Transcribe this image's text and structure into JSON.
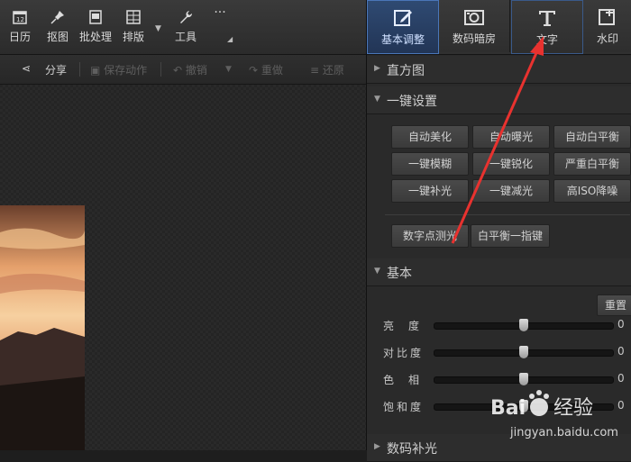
{
  "toolbar": {
    "items": [
      {
        "label": "日历",
        "icon": "calendar-icon"
      },
      {
        "label": "抠图",
        "icon": "pin-icon"
      },
      {
        "label": "批处理",
        "icon": "batch-icon"
      },
      {
        "label": "排版",
        "icon": "layout-icon"
      },
      {
        "label": "工具",
        "icon": "wrench-icon"
      }
    ],
    "more": "···"
  },
  "subtoolbar": {
    "share": "分享",
    "save_action": "保存动作",
    "undo": "撤销",
    "redo": "重做",
    "restore": "还原"
  },
  "tabs": [
    {
      "label": "基本调整",
      "icon": "edit-icon",
      "active": true
    },
    {
      "label": "数码暗房",
      "icon": "camera-icon",
      "active": false
    },
    {
      "label": "文字",
      "icon": "text-icon",
      "active": false,
      "pressed": true
    },
    {
      "label": "水印",
      "icon": "watermark-icon",
      "active": false
    }
  ],
  "sections": {
    "histogram": "直方图",
    "oneclick": "一键设置",
    "basic": "基本",
    "digital": "数码补光"
  },
  "oneclick_buttons": [
    [
      "自动美化",
      "自动曝光",
      "自动白平衡"
    ],
    [
      "一键模糊",
      "一键锐化",
      "严重白平衡"
    ],
    [
      "一键补光",
      "一键减光",
      "高ISO降噪"
    ]
  ],
  "extra_buttons": [
    "数字点测光",
    "白平衡一指键"
  ],
  "basic": {
    "reset": "重置",
    "sliders": [
      {
        "label": "亮　度",
        "value": "0",
        "level": 0.5
      },
      {
        "label": "对比度",
        "value": "0",
        "level": 0.5
      },
      {
        "label": "色　相",
        "value": "0",
        "level": 0.5
      },
      {
        "label": "饱和度",
        "value": "0",
        "level": 0.5
      }
    ]
  },
  "watermark": {
    "brand": "Bai",
    "brand2": "经验",
    "site": "jingyan.baidu.com"
  },
  "colors": {
    "accent": "#2f4a72",
    "arrow": "#e8322f"
  }
}
